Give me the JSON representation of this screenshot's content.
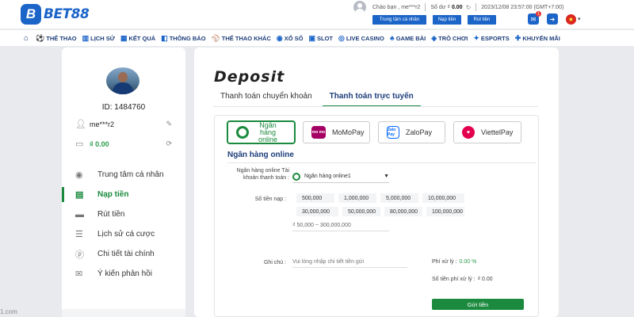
{
  "header": {
    "logo_letter": "B",
    "logo_text": "BET88",
    "greeting": "Chào bạn , me***r2",
    "balance_label": "Số dư ₫",
    "balance_value": "0.00",
    "datetime": "2023/12/08 23:57:00 (GMT+7:00)",
    "buttons": [
      "Trung tâm cá nhân",
      "Nạp tiền",
      "Rút tiền"
    ],
    "notification_count": "1"
  },
  "nav": {
    "items": [
      {
        "icon": "soccer-icon",
        "label": "THỂ THAO"
      },
      {
        "icon": "history-icon",
        "label": "LỊCH SỬ"
      },
      {
        "icon": "results-icon",
        "label": "KẾT QUẢ"
      },
      {
        "icon": "announcement-icon",
        "label": "THÔNG BÁO"
      },
      {
        "icon": "other-sports-icon",
        "label": "THỂ THAO KHÁC"
      },
      {
        "icon": "lottery-icon",
        "label": "XỔ SỐ"
      },
      {
        "icon": "slot-icon",
        "label": "SLOT"
      },
      {
        "icon": "live-casino-icon",
        "label": "LIVE CASINO"
      },
      {
        "icon": "card-game-icon",
        "label": "GAME BÀI"
      },
      {
        "icon": "games-icon",
        "label": "TRÒ CHƠI"
      },
      {
        "icon": "esports-icon",
        "label": "ESPORTS"
      },
      {
        "icon": "promotion-icon",
        "label": "KHUYẾN MÃI"
      }
    ]
  },
  "sidebar": {
    "user_id": "ID: 1484760",
    "username": "me***r2",
    "balance": "₫ 0.00",
    "menu": [
      {
        "icon": "user-circle-icon",
        "label": "Trung tâm cá nhân",
        "active": false
      },
      {
        "icon": "deposit-icon",
        "label": "Nạp tiền",
        "active": true
      },
      {
        "icon": "withdraw-icon",
        "label": "Rút tiền",
        "active": false
      },
      {
        "icon": "bet-history-icon",
        "label": "Lịch sử cá cược",
        "active": false
      },
      {
        "icon": "finance-detail-icon",
        "label": "Chi tiết tài chính",
        "active": false
      },
      {
        "icon": "feedback-icon",
        "label": "Ý kiến phản hồi",
        "active": false
      }
    ]
  },
  "deposit": {
    "title": "Deposit",
    "tabs": [
      "Thanh toán chuyển khoản",
      "Thanh toán trực tuyến"
    ],
    "active_tab": 1,
    "methods": [
      {
        "icon": "bank-icon",
        "label": "Ngân hàng online",
        "selected": true
      },
      {
        "icon": "momo-icon",
        "label": "MoMoPay",
        "selected": false
      },
      {
        "icon": "zalopay-icon",
        "label": "ZaloPay",
        "selected": false
      },
      {
        "icon": "viettelpay-icon",
        "label": "ViettelPay",
        "selected": false
      }
    ],
    "momo_badge": "mo mo",
    "zalo_badge": "Zalo Pay",
    "section_title": "Ngân hàng online",
    "bank_field_label_1": "Ngân hàng online Tài",
    "bank_field_label_2": "khoản thanh toán :",
    "bank_selected": "Ngân hàng online1",
    "amount_label": "Số tiền nạp :",
    "amount_options": [
      "500,000",
      "1,000,000",
      "5,000,000",
      "10,000,000",
      "30,000,000",
      "50,000,000",
      "80,000,000",
      "100,000,000"
    ],
    "amount_range_placeholder": "₫ 50,000 ~ 300,000,000",
    "note_label": "Ghi chú :",
    "note_placeholder": "Vui lòng nhập chi tiết tiền gửi",
    "fee_label": "Phí xử lý :",
    "fee_value": "0.00 %",
    "fee_amount_label": "Số tiền phí xử lý :",
    "fee_amount_value": "₫ 0.00",
    "submit_label": "Gửi tiền"
  },
  "footer_url_fragment": "1.com",
  "colors": {
    "brand_blue": "#1b64c8",
    "accent_green": "#1b8a3e"
  }
}
